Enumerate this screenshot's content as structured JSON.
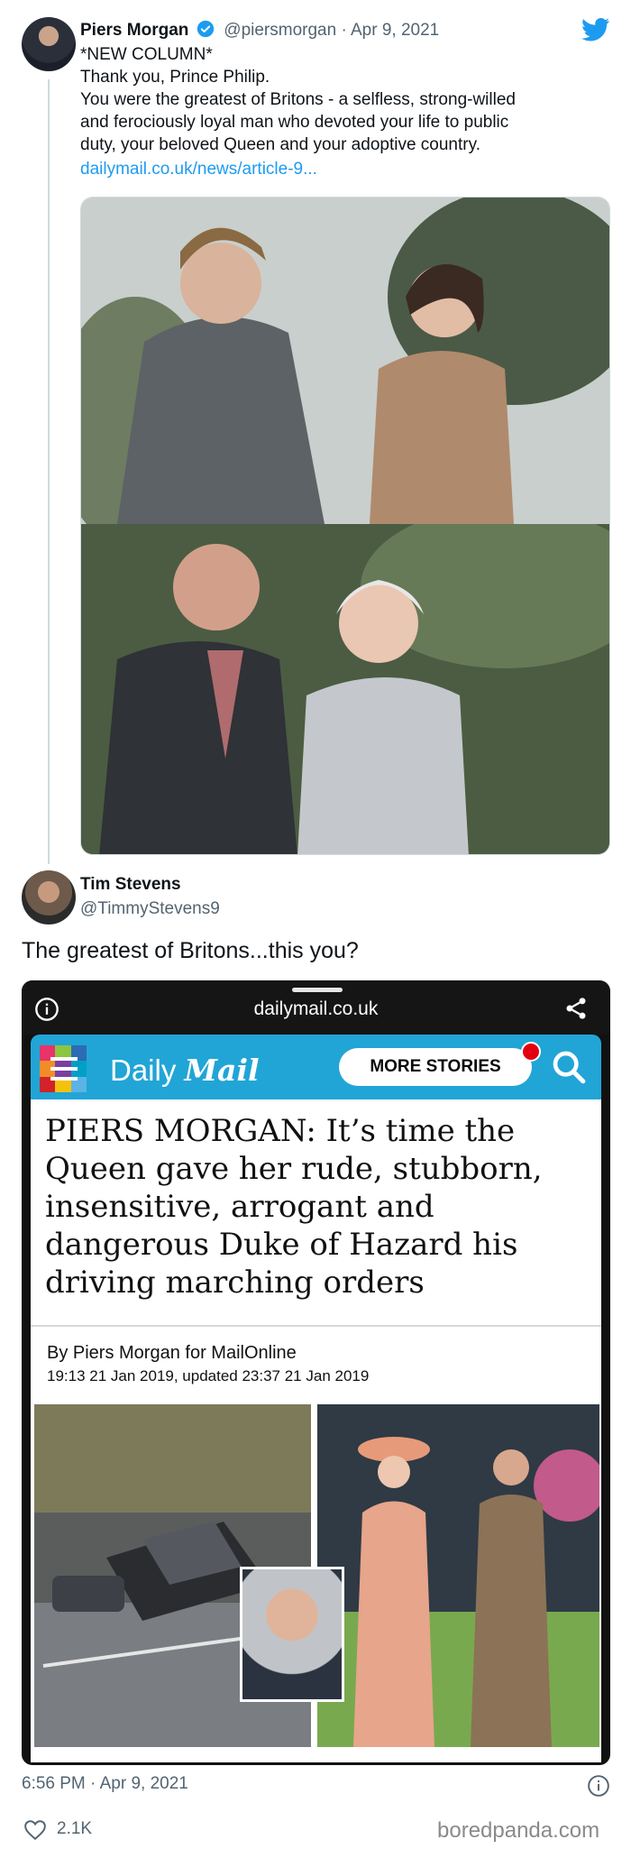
{
  "tweet": {
    "name": "Piers Morgan",
    "handle": "@piersmorgan · Apr 9, 2021",
    "body": "*NEW COLUMN*\nThank you, Prince Philip.\nYou were the greatest of Britons - a selfless, strong-willed\nand ferociously loyal man who devoted your life to public\nduty, your beloved Queen and your adoptive country.",
    "link": "dailymail.co.uk/news/article-9..."
  },
  "reply": {
    "name": "Tim Stevens",
    "handle": "@TimmyStevens9",
    "text": "The greatest of Britons...this you?"
  },
  "screenshot": {
    "url": "dailymail.co.uk",
    "brand_daily": "Daily",
    "brand_mail": "Mail",
    "more_stories": "MORE STORIES",
    "headline": "PIERS MORGAN: It’s time the Queen gave her rude, stubborn, insensitive, arrogant and dangerous Duke of Hazard his driving marching orders",
    "byline": "By Piers Morgan for MailOnline",
    "dateline": "19:13 21 Jan 2019, updated 23:37 21 Jan 2019"
  },
  "footer": {
    "timestamp": "6:56 PM · Apr 9, 2021",
    "likes": "2.1K",
    "watermark": "boredpanda.com"
  },
  "colors": {
    "twitter_blue": "#1d9bf0",
    "dailymail_blue": "#21a5d6",
    "notification_red": "#e3000f"
  }
}
